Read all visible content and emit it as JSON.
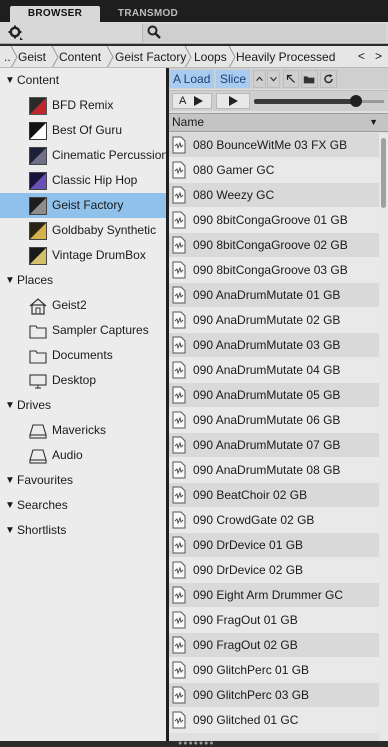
{
  "tabs": {
    "browser": "BROWSER",
    "transmod": "TRANSMOD"
  },
  "breadcrumb": {
    "items": [
      "..",
      "Geist",
      "Content",
      "Geist Factory",
      "Loops",
      "Heavily Processed"
    ],
    "back": "<",
    "forward": ">"
  },
  "tree": {
    "content": {
      "label": "Content",
      "items": [
        {
          "label": "BFD Remix",
          "icon": "bfd-remix-icon"
        },
        {
          "label": "Best Of Guru",
          "icon": "best-of-guru-icon"
        },
        {
          "label": "Cinematic Percussion",
          "icon": "cinematic-percussion-icon"
        },
        {
          "label": "Classic Hip Hop",
          "icon": "classic-hip-hop-icon"
        },
        {
          "label": "Geist Factory",
          "icon": "geist-factory-icon",
          "selected": true
        },
        {
          "label": "Goldbaby Synthetic",
          "icon": "goldbaby-synthetic-icon"
        },
        {
          "label": "Vintage DrumBox",
          "icon": "vintage-drumbox-icon"
        }
      ]
    },
    "places": {
      "label": "Places",
      "items": [
        {
          "label": "Geist2",
          "icon": "home-icon"
        },
        {
          "label": "Sampler Captures",
          "icon": "folder-icon"
        },
        {
          "label": "Documents",
          "icon": "folder-icon"
        },
        {
          "label": "Desktop",
          "icon": "desktop-icon"
        }
      ]
    },
    "drives": {
      "label": "Drives",
      "items": [
        {
          "label": "Mavericks",
          "icon": "drive-icon"
        },
        {
          "label": "Audio",
          "icon": "drive-icon"
        }
      ]
    },
    "favourites": {
      "label": "Favourites"
    },
    "searches": {
      "label": "Searches"
    },
    "shortlists": {
      "label": "Shortlists"
    }
  },
  "controls": {
    "a_load": "A Load",
    "slice": "Slice",
    "a_play": "A",
    "volume_level": 0.93
  },
  "file_list": {
    "column_name": "Name",
    "files": [
      "080 BounceWitMe 03 FX GB",
      "080 Gamer GC",
      "080 Weezy GC",
      "090 8bitCongaGroove 01 GB",
      "090 8bitCongaGroove 02 GB",
      "090 8bitCongaGroove 03 GB",
      "090 AnaDrumMutate 01 GB",
      "090 AnaDrumMutate 02 GB",
      "090 AnaDrumMutate 03 GB",
      "090 AnaDrumMutate 04 GB",
      "090 AnaDrumMutate 05 GB",
      "090 AnaDrumMutate 06 GB",
      "090 AnaDrumMutate 07 GB",
      "090 AnaDrumMutate 08 GB",
      "090 BeatChoir 02 GB",
      "090 CrowdGate 02 GB",
      "090 DrDevice 01 GB",
      "090 DrDevice 02 GB",
      "090 Eight Arm Drummer GC",
      "090 FragOut 01 GB",
      "090 FragOut 02 GB",
      "090 GlitchPerc 01 GB",
      "090 GlitchPerc 03 GB",
      "090 Glitched 01 GC"
    ]
  },
  "colors": {
    "selection": "#8fc1ea",
    "button_blue": "#a9cbef",
    "panel_dark": "#1e1e1e"
  }
}
